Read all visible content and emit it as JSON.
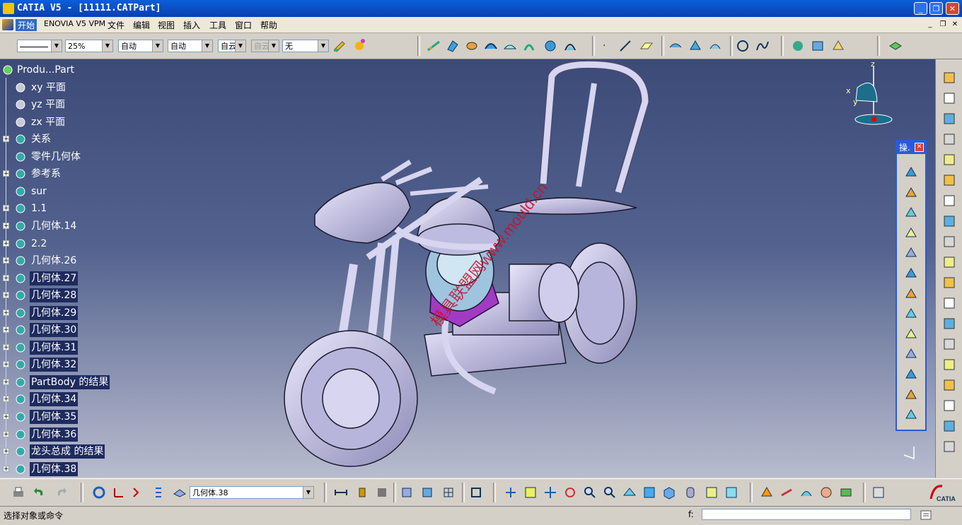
{
  "window": {
    "title": "CATIA V5 - [11111.CATPart]"
  },
  "menu": {
    "items": [
      "开始",
      "ENOVIA V5 VPM",
      "文件",
      "编辑",
      "视图",
      "插入",
      "工具",
      "窗口",
      "帮助"
    ]
  },
  "toolbar": {
    "line_style": "",
    "zoom": "25%",
    "thickness": "自动",
    "line_type": "自动",
    "layer_short": "自云",
    "disabled_combo": "自云",
    "layer": "无"
  },
  "tree": {
    "root": "Produ...Part",
    "nodes": [
      {
        "label": "xy 平面",
        "expand": false,
        "selected": false
      },
      {
        "label": "yz 平面",
        "expand": false,
        "selected": false
      },
      {
        "label": "zx 平面",
        "expand": false,
        "selected": false
      },
      {
        "label": "关系",
        "expand": true,
        "selected": false
      },
      {
        "label": "零件几何体",
        "expand": false,
        "selected": false
      },
      {
        "label": "参考系",
        "expand": true,
        "selected": false
      },
      {
        "label": "sur",
        "expand": false,
        "selected": false
      },
      {
        "label": "1.1",
        "expand": true,
        "selected": false
      },
      {
        "label": "几何体.14",
        "expand": true,
        "selected": false
      },
      {
        "label": "2.2",
        "expand": true,
        "selected": false
      },
      {
        "label": "几何体.26",
        "expand": true,
        "selected": false
      },
      {
        "label": "几何体.27",
        "expand": true,
        "selected": true
      },
      {
        "label": "几何体.28",
        "expand": true,
        "selected": true
      },
      {
        "label": "几何体.29",
        "expand": true,
        "selected": true
      },
      {
        "label": "几何体.30",
        "expand": true,
        "selected": true
      },
      {
        "label": "几何体.31",
        "expand": true,
        "selected": true
      },
      {
        "label": "几何体.32",
        "expand": true,
        "selected": true
      },
      {
        "label": "PartBody 的结果",
        "expand": true,
        "selected": true
      },
      {
        "label": "几何体.34",
        "expand": true,
        "selected": true
      },
      {
        "label": "几何体.35",
        "expand": true,
        "selected": true
      },
      {
        "label": "几何体.36",
        "expand": true,
        "selected": true
      },
      {
        "label": "龙头总成 的结果",
        "expand": true,
        "selected": true
      },
      {
        "label": "几何体.38",
        "expand": true,
        "selected": true
      }
    ]
  },
  "compass": {
    "x": "x",
    "y": "y",
    "z": "z"
  },
  "float_panel": {
    "title": "操."
  },
  "bottom_toolbar": {
    "current_body": "几何体.38"
  },
  "status": {
    "prompt": "选择对象或命令",
    "cmd_label": "f:"
  },
  "watermark": {
    "text": "模具联盟网www.mould.cn"
  },
  "colors": {
    "accent": "#0b3fb0",
    "viewport_top": "#3c4a78",
    "selection": "#1e2b5e",
    "part": "#c9c6e8",
    "highlight": "#9b2fc0"
  }
}
